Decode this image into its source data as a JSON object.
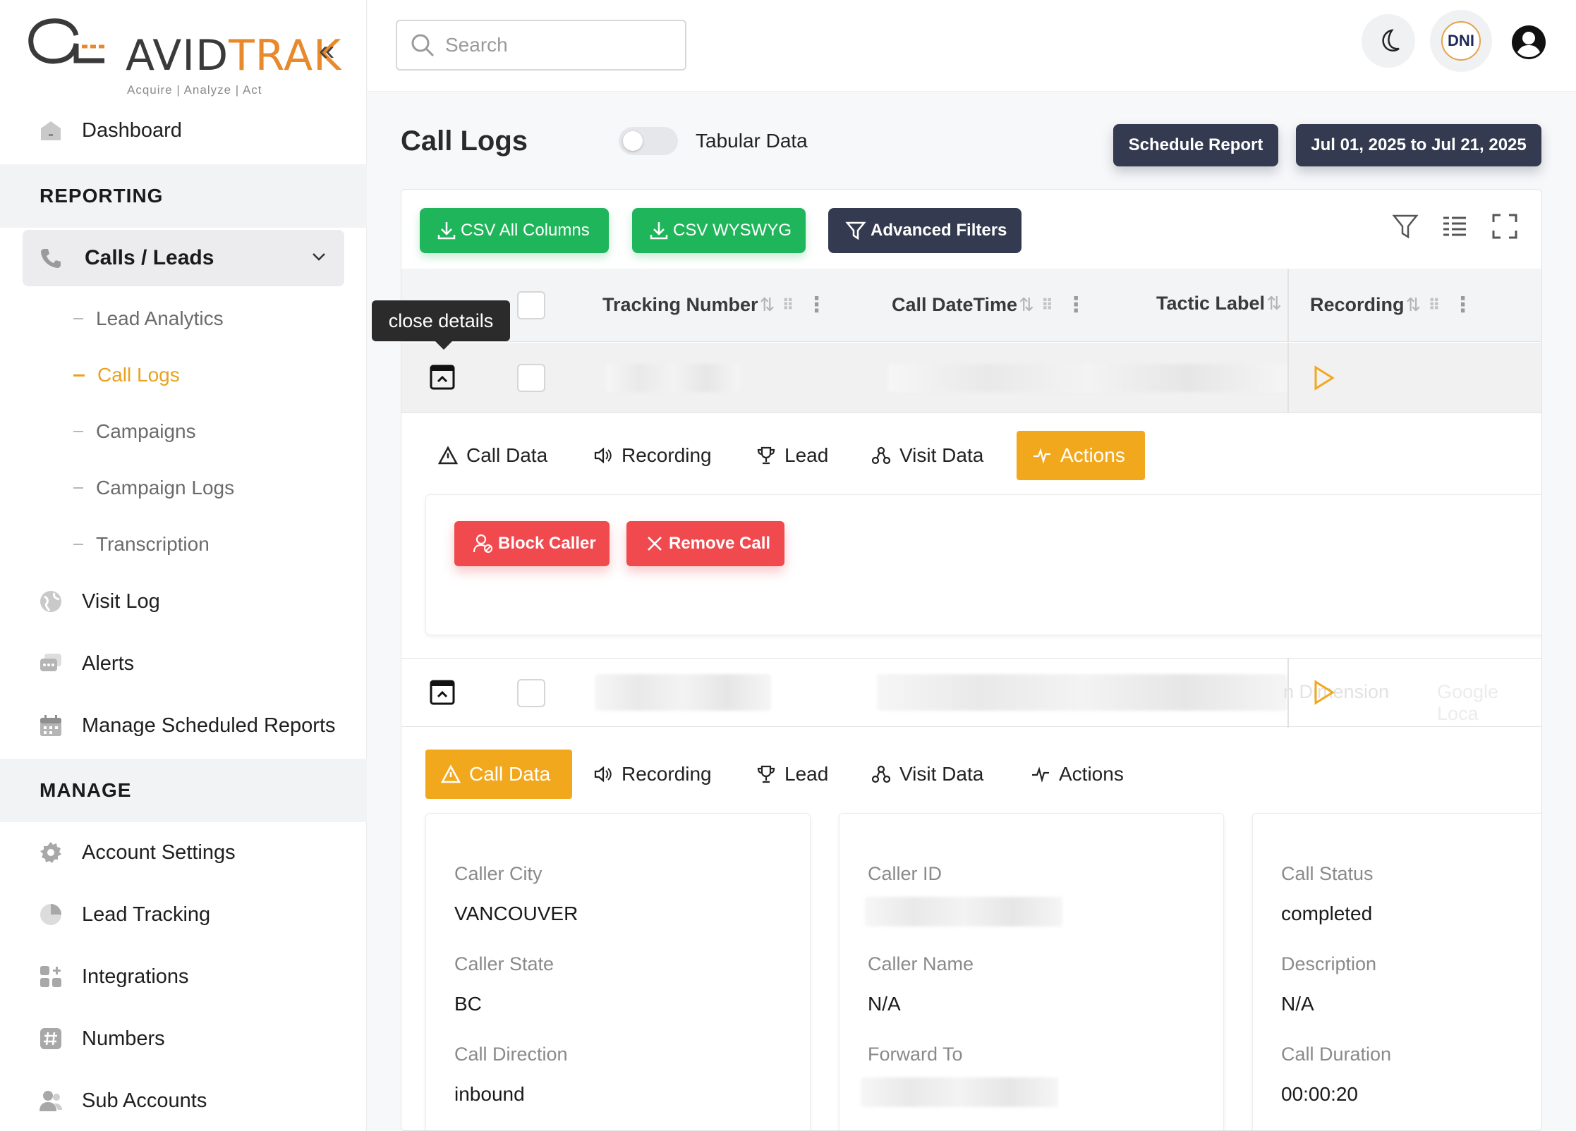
{
  "brand": {
    "name_part1": "AVID",
    "name_part2": "TRAK",
    "tagline": "Acquire  |  Analyze  |  Act",
    "accent": "#e8892b"
  },
  "sidebar": {
    "dashboard": "Dashboard",
    "reporting_header": "REPORTING",
    "calls_leads": "Calls / Leads",
    "sub_items": [
      "Lead Analytics",
      "Call Logs",
      "Campaigns",
      "Campaign Logs",
      "Transcription"
    ],
    "visit_log": "Visit Log",
    "alerts": "Alerts",
    "scheduled_reports": "Manage Scheduled Reports",
    "manage_header": "MANAGE",
    "manage_items": [
      "Account Settings",
      "Lead Tracking",
      "Integrations",
      "Numbers",
      "Sub Accounts"
    ]
  },
  "topbar": {
    "search_placeholder": "Search",
    "dni_label": "DNI"
  },
  "header": {
    "title": "Call Logs",
    "toggle_label": "Tabular Data",
    "toggle_on": false,
    "schedule_report": "Schedule Report",
    "date_range": "Jul 01, 2025 to Jul 21, 2025"
  },
  "toolbar": {
    "csv_all": "CSV All Columns",
    "csv_wysiwyg": "CSV WYSWYG",
    "advanced_filters": "Advanced Filters"
  },
  "table": {
    "columns": [
      "Tracking Number",
      "Call DateTime",
      "Tactic Label",
      "Recording"
    ],
    "tooltip": "close details"
  },
  "detail_tabs": [
    "Call Data",
    "Recording",
    "Lead",
    "Visit Data",
    "Actions"
  ],
  "actions": {
    "block_caller": "Block Caller",
    "remove_call": "Remove Call"
  },
  "row2_faded": {
    "dimension": "n Dimension",
    "tactic": "Google Loca"
  },
  "call_data": {
    "col1": [
      {
        "label": "Caller City",
        "value": "VANCOUVER"
      },
      {
        "label": "Caller State",
        "value": "BC"
      },
      {
        "label": "Call Direction",
        "value": "inbound"
      }
    ],
    "col2": [
      {
        "label": "Caller ID",
        "value": ""
      },
      {
        "label": "Caller Name",
        "value": "N/A"
      },
      {
        "label": "Forward To",
        "value": ""
      }
    ],
    "col3": [
      {
        "label": "Call Status",
        "value": "completed"
      },
      {
        "label": "Description",
        "value": "N/A"
      },
      {
        "label": "Call Duration",
        "value": "00:00:20"
      }
    ]
  },
  "colors": {
    "active_tab": "#f2a81d",
    "green": "#1fb55a",
    "red": "#f04a4f",
    "dark": "#343a4f"
  }
}
